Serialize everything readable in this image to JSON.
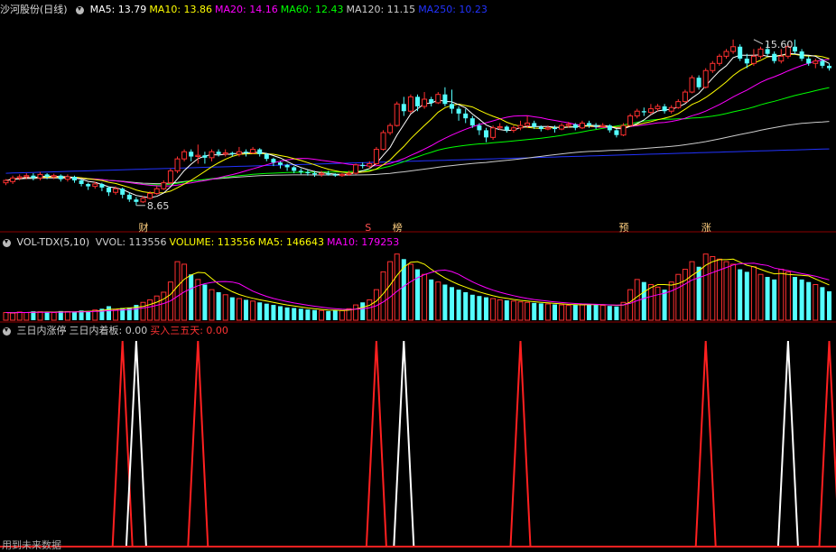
{
  "header": {
    "title": "沙河股份(日线)",
    "ma": [
      {
        "label": "MA5: 13.79",
        "color": "#ffffff"
      },
      {
        "label": "MA10: 13.86",
        "color": "#ffff00"
      },
      {
        "label": "MA20: 14.16",
        "color": "#ff00ff"
      },
      {
        "label": "MA60: 12.43",
        "color": "#00ff00"
      },
      {
        "label": "MA120: 11.15",
        "color": "#cccccc"
      },
      {
        "label": "MA250: 10.23",
        "color": "#2233ff"
      }
    ]
  },
  "volume_header": {
    "title": "VOL-TDX(5,10)",
    "items": [
      {
        "label": "VVOL: 113556",
        "color": "#cccccc"
      },
      {
        "label": "VOLUME: 113556",
        "color": "#ffff00"
      },
      {
        "label": "MA5: 146643",
        "color": "#ffff00"
      },
      {
        "label": "MA10: 179253",
        "color": "#ff00ff"
      }
    ]
  },
  "indicator_header": {
    "items": [
      {
        "label": "三日内涨停",
        "color": "#cccccc"
      },
      {
        "label": "三日内着板: 0.00",
        "color": "#cccccc"
      },
      {
        "label": "买入三五天: 0.00",
        "color": "#ff3333"
      }
    ]
  },
  "footer": "用到未来数据",
  "chart_data": [
    {
      "type": "candlestick",
      "price_range": [
        8.0,
        16.5
      ],
      "annotations": [
        {
          "text": "15.60",
          "index": 109,
          "price": 15.6
        },
        {
          "text": "8.65",
          "index": 19,
          "price": 8.65
        }
      ],
      "markers": [
        {
          "text": "财",
          "index": 20
        },
        {
          "text": "S",
          "index": 53
        },
        {
          "text": "榜",
          "index": 57
        },
        {
          "text": "预",
          "index": 90
        },
        {
          "text": "涨",
          "index": 102
        }
      ],
      "candles": [
        [
          9.6,
          9.7,
          9.5,
          9.75
        ],
        [
          9.65,
          9.8,
          9.55,
          9.9
        ],
        [
          9.8,
          9.85,
          9.7,
          9.95
        ],
        [
          9.85,
          9.9,
          9.75,
          10.0
        ],
        [
          9.9,
          9.8,
          9.7,
          10.0
        ],
        [
          9.8,
          9.95,
          9.7,
          10.05
        ],
        [
          9.95,
          9.85,
          9.75,
          10.0
        ],
        [
          9.85,
          9.9,
          9.75,
          9.98
        ],
        [
          9.9,
          9.75,
          9.65,
          9.95
        ],
        [
          9.75,
          9.85,
          9.65,
          9.95
        ],
        [
          9.85,
          9.7,
          9.6,
          9.9
        ],
        [
          9.7,
          9.55,
          9.45,
          9.75
        ],
        [
          9.55,
          9.45,
          9.3,
          9.6
        ],
        [
          9.45,
          9.55,
          9.35,
          9.65
        ],
        [
          9.55,
          9.4,
          9.25,
          9.6
        ],
        [
          9.4,
          9.2,
          9.05,
          9.45
        ],
        [
          9.2,
          9.35,
          9.1,
          9.45
        ],
        [
          9.35,
          9.1,
          8.95,
          9.4
        ],
        [
          9.1,
          8.9,
          8.8,
          9.2
        ],
        [
          8.9,
          8.8,
          8.65,
          9.0
        ],
        [
          8.8,
          8.95,
          8.75,
          9.05
        ],
        [
          8.95,
          9.15,
          8.9,
          9.25
        ],
        [
          9.15,
          9.35,
          9.1,
          9.45
        ],
        [
          9.35,
          9.6,
          9.3,
          9.7
        ],
        [
          9.6,
          10.1,
          9.55,
          10.2
        ],
        [
          10.1,
          10.6,
          10.0,
          10.7
        ],
        [
          10.6,
          10.9,
          10.5,
          11.0
        ],
        [
          10.9,
          10.7,
          10.5,
          11.0
        ],
        [
          10.7,
          10.75,
          10.4,
          11.2
        ],
        [
          10.75,
          10.65,
          10.4,
          10.9
        ],
        [
          10.65,
          10.9,
          10.5,
          11.0
        ],
        [
          10.9,
          10.8,
          10.7,
          11.0
        ],
        [
          10.8,
          10.85,
          10.7,
          11.0
        ],
        [
          10.85,
          10.8,
          10.7,
          10.9
        ],
        [
          10.8,
          10.9,
          10.7,
          11.1
        ],
        [
          10.9,
          10.85,
          10.7,
          11.0
        ],
        [
          10.85,
          11.0,
          10.8,
          11.1
        ],
        [
          11.0,
          10.8,
          10.7,
          11.05
        ],
        [
          10.8,
          10.6,
          10.5,
          10.85
        ],
        [
          10.6,
          10.45,
          10.3,
          10.65
        ],
        [
          10.45,
          10.35,
          10.2,
          10.5
        ],
        [
          10.35,
          10.25,
          10.1,
          10.4
        ],
        [
          10.25,
          10.1,
          10.0,
          10.3
        ],
        [
          10.1,
          10.05,
          9.95,
          10.2
        ],
        [
          10.05,
          10.0,
          9.9,
          10.15
        ],
        [
          10.0,
          9.95,
          9.85,
          10.1
        ],
        [
          9.95,
          10.0,
          9.85,
          10.1
        ],
        [
          10.0,
          9.95,
          9.9,
          10.1
        ],
        [
          9.95,
          9.9,
          9.85,
          10.0
        ],
        [
          9.9,
          9.95,
          9.85,
          10.0
        ],
        [
          9.95,
          10.0,
          9.9,
          10.1
        ],
        [
          10.0,
          10.35,
          9.95,
          10.4
        ],
        [
          10.35,
          10.3,
          10.2,
          10.45
        ],
        [
          10.3,
          10.4,
          10.2,
          10.5
        ],
        [
          10.4,
          11.0,
          10.35,
          11.1
        ],
        [
          11.0,
          11.7,
          10.95,
          11.8
        ],
        [
          11.7,
          12.0,
          11.6,
          12.1
        ],
        [
          12.0,
          12.9,
          11.95,
          13.0
        ],
        [
          12.9,
          12.6,
          12.4,
          13.2
        ],
        [
          12.6,
          13.2,
          12.5,
          13.3
        ],
        [
          13.2,
          12.8,
          12.6,
          13.3
        ],
        [
          12.8,
          13.1,
          12.7,
          13.4
        ],
        [
          13.1,
          12.95,
          12.8,
          13.2
        ],
        [
          12.95,
          13.3,
          12.9,
          13.4
        ],
        [
          13.3,
          12.9,
          12.8,
          13.6
        ],
        [
          12.9,
          12.7,
          12.5,
          13.5
        ],
        [
          12.7,
          12.5,
          12.2,
          12.8
        ],
        [
          12.5,
          12.3,
          12.1,
          12.7
        ],
        [
          12.3,
          12.0,
          11.9,
          12.4
        ],
        [
          12.0,
          11.8,
          11.6,
          12.1
        ],
        [
          11.8,
          11.5,
          11.3,
          11.9
        ],
        [
          11.5,
          11.9,
          11.4,
          12.0
        ],
        [
          11.9,
          11.95,
          11.8,
          12.1
        ],
        [
          11.95,
          11.8,
          11.7,
          12.0
        ],
        [
          11.8,
          11.9,
          11.7,
          12.0
        ],
        [
          11.9,
          12.0,
          11.8,
          12.2
        ],
        [
          12.0,
          12.1,
          11.9,
          12.4
        ],
        [
          12.1,
          11.95,
          11.85,
          12.2
        ],
        [
          11.95,
          11.85,
          11.75,
          12.0
        ],
        [
          11.85,
          11.9,
          11.8,
          12.0
        ],
        [
          11.9,
          11.85,
          11.7,
          12.0
        ],
        [
          11.85,
          12.0,
          11.8,
          12.1
        ],
        [
          12.0,
          12.05,
          11.9,
          12.15
        ],
        [
          12.05,
          11.9,
          11.8,
          12.1
        ],
        [
          11.9,
          12.1,
          11.85,
          12.2
        ],
        [
          12.1,
          12.0,
          11.9,
          12.2
        ],
        [
          12.0,
          11.95,
          11.85,
          12.1
        ],
        [
          11.95,
          12.0,
          11.9,
          12.1
        ],
        [
          12.0,
          11.8,
          11.7,
          12.05
        ],
        [
          11.8,
          11.6,
          11.5,
          11.85
        ],
        [
          11.6,
          12.0,
          11.55,
          12.1
        ],
        [
          12.0,
          12.4,
          11.95,
          12.5
        ],
        [
          12.4,
          12.6,
          12.3,
          12.7
        ],
        [
          12.6,
          12.55,
          12.4,
          12.75
        ],
        [
          12.55,
          12.7,
          12.45,
          12.9
        ],
        [
          12.7,
          12.8,
          12.6,
          12.9
        ],
        [
          12.8,
          12.6,
          12.5,
          12.9
        ],
        [
          12.6,
          12.75,
          12.5,
          12.85
        ],
        [
          12.75,
          13.0,
          12.7,
          13.1
        ],
        [
          13.0,
          13.4,
          12.95,
          13.5
        ],
        [
          13.4,
          14.0,
          13.35,
          14.1
        ],
        [
          14.0,
          13.6,
          13.5,
          14.1
        ],
        [
          13.6,
          14.3,
          13.55,
          14.4
        ],
        [
          14.3,
          14.6,
          14.2,
          14.7
        ],
        [
          14.6,
          14.9,
          14.5,
          15.0
        ],
        [
          14.9,
          15.1,
          14.8,
          15.2
        ],
        [
          15.1,
          15.3,
          15.0,
          15.6
        ],
        [
          15.3,
          14.8,
          14.7,
          15.4
        ],
        [
          14.8,
          14.6,
          14.4,
          15.0
        ],
        [
          14.6,
          14.9,
          14.5,
          15.2
        ],
        [
          14.9,
          15.2,
          14.8,
          15.3
        ],
        [
          15.2,
          15.0,
          14.9,
          15.4
        ],
        [
          15.0,
          14.7,
          14.6,
          15.1
        ],
        [
          14.7,
          14.9,
          14.6,
          15.2
        ],
        [
          14.9,
          15.3,
          14.8,
          15.4
        ],
        [
          15.3,
          15.1,
          15.0,
          15.6
        ],
        [
          15.1,
          14.8,
          14.7,
          15.2
        ],
        [
          14.8,
          14.6,
          14.5,
          14.9
        ],
        [
          14.6,
          14.7,
          14.4,
          14.8
        ],
        [
          14.7,
          14.5,
          14.4,
          14.8
        ],
        [
          14.5,
          14.4,
          14.3,
          14.6
        ]
      ]
    },
    {
      "type": "bar",
      "series_name": "VOLUME",
      "vol_range": [
        0,
        280000
      ],
      "values": [
        30000,
        28000,
        32000,
        30000,
        35000,
        33000,
        31000,
        30000,
        36000,
        34000,
        32000,
        38000,
        35000,
        40000,
        45000,
        55000,
        42000,
        48000,
        50000,
        60000,
        70000,
        80000,
        95000,
        110000,
        150000,
        230000,
        220000,
        180000,
        160000,
        140000,
        120000,
        110000,
        100000,
        90000,
        85000,
        80000,
        75000,
        70000,
        65000,
        60000,
        55000,
        50000,
        48000,
        45000,
        42000,
        40000,
        38000,
        36000,
        40000,
        38000,
        45000,
        60000,
        70000,
        80000,
        120000,
        190000,
        230000,
        260000,
        240000,
        220000,
        200000,
        180000,
        160000,
        150000,
        140000,
        130000,
        120000,
        110000,
        100000,
        95000,
        90000,
        85000,
        80000,
        78000,
        75000,
        72000,
        70000,
        68000,
        66000,
        64000,
        62000,
        60000,
        58000,
        60000,
        62000,
        64000,
        60000,
        58000,
        56000,
        54000,
        70000,
        120000,
        160000,
        150000,
        140000,
        130000,
        120000,
        150000,
        180000,
        200000,
        230000,
        210000,
        260000,
        250000,
        240000,
        230000,
        220000,
        200000,
        190000,
        210000,
        180000,
        170000,
        160000,
        200000,
        190000,
        170000,
        160000,
        150000,
        140000,
        130000,
        113556
      ]
    },
    {
      "type": "line",
      "series": [
        {
          "name": "三日内涨停",
          "color": "#ff2020",
          "spikes": [
            17,
            28,
            54,
            75,
            102,
            120
          ]
        },
        {
          "name": "三日内着板",
          "color": "#ffffff",
          "spikes": [
            19,
            58,
            114
          ]
        }
      ],
      "ylim": [
        0,
        1
      ]
    }
  ]
}
